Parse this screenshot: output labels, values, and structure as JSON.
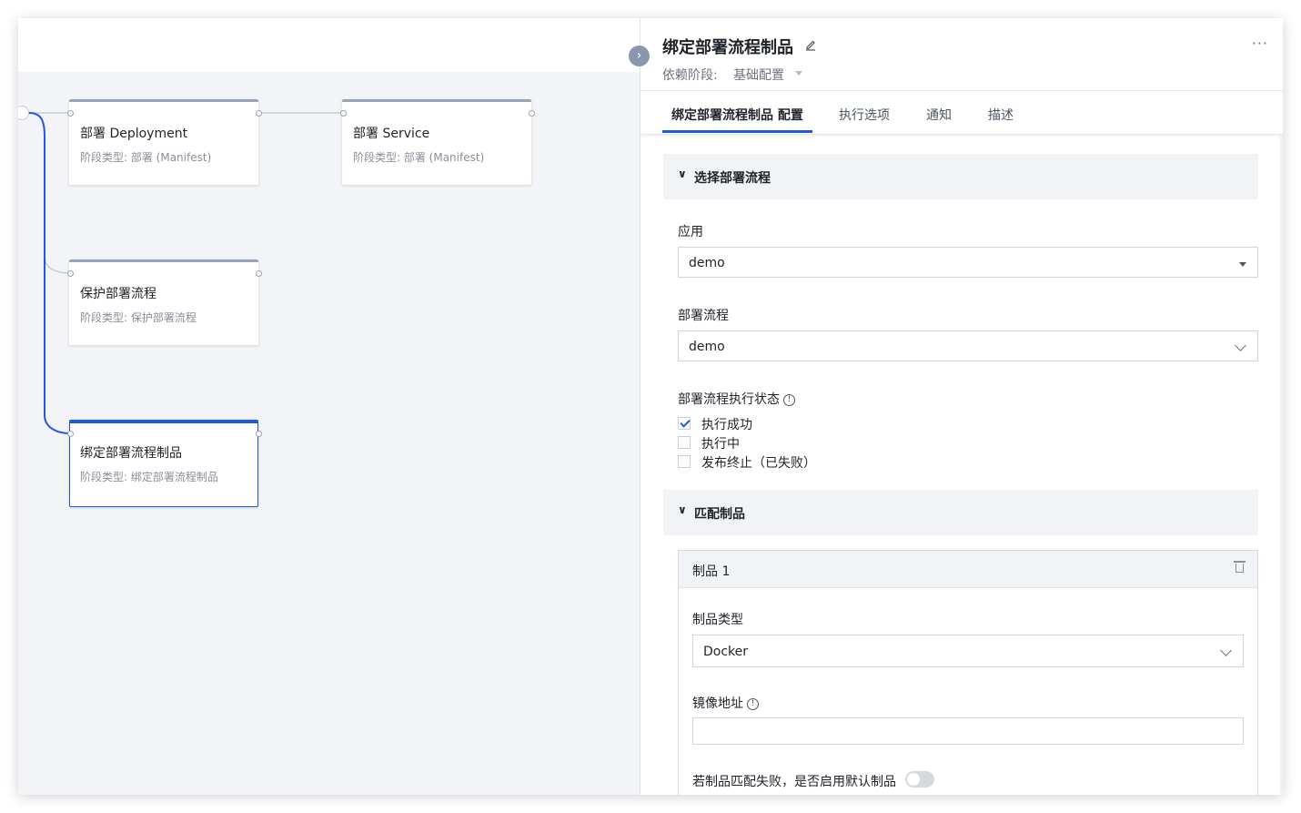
{
  "canvas": {
    "nodes": [
      {
        "title": "部署 Deployment",
        "subtitle": "阶段类型: 部署 (Manifest)"
      },
      {
        "title": "部署 Service",
        "subtitle": "阶段类型: 部署 (Manifest)"
      },
      {
        "title": "保护部署流程",
        "subtitle": "阶段类型: 保护部署流程"
      },
      {
        "title": "绑定部署流程制品",
        "subtitle": "阶段类型: 绑定部署流程制品"
      }
    ],
    "colors": {
      "edge": "#c5cbd5",
      "active": "#1f57e6"
    }
  },
  "panel": {
    "title": "绑定部署流程制品",
    "dependency_label": "依赖阶段:",
    "dependency_value": "基础配置",
    "tabs": [
      "绑定部署流程制品 配置",
      "执行选项",
      "通知",
      "描述"
    ],
    "active_tab": "绑定部署流程制品 配置",
    "section_select": {
      "header": "选择部署流程",
      "app_label": "应用",
      "app_value": "demo",
      "pipeline_label": "部署流程",
      "pipeline_value": "demo",
      "status_label": "部署流程执行状态",
      "status_options": [
        {
          "label": "执行成功",
          "checked": true
        },
        {
          "label": "执行中",
          "checked": false
        },
        {
          "label": "发布终止（已失败）",
          "checked": false
        }
      ]
    },
    "section_match": {
      "header": "匹配制品",
      "artifact_name": "制品 1",
      "type_label": "制品类型",
      "type_value": "Docker",
      "image_label": "镜像地址",
      "image_value": "",
      "fallback_label": "若制品匹配失败，是否启用默认制品",
      "fallback_enabled": false
    }
  }
}
